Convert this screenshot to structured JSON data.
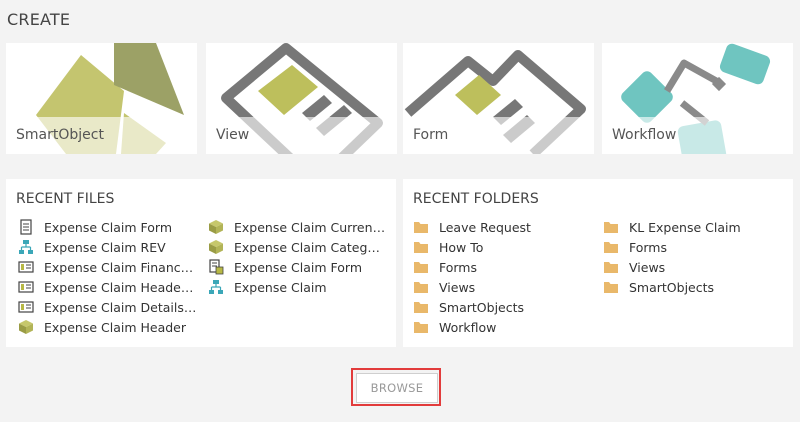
{
  "create": {
    "title": "CREATE",
    "tiles": [
      {
        "label": "SmartObject"
      },
      {
        "label": "View"
      },
      {
        "label": "Form"
      },
      {
        "label": "Workflow"
      }
    ]
  },
  "recent_files": {
    "title": "RECENT FILES",
    "items": [
      {
        "label": "Expense Claim Form",
        "icon": "form-icon"
      },
      {
        "label": "Expense Claim REV",
        "icon": "workflow-icon"
      },
      {
        "label": "Expense Claim Finance P...",
        "icon": "view-icon"
      },
      {
        "label": "Expense Claim Header V...",
        "icon": "view-icon"
      },
      {
        "label": "Expense Claim Details Vi...",
        "icon": "view-icon"
      },
      {
        "label": "Expense Claim Header",
        "icon": "smartobject-icon"
      },
      {
        "label": "Expense Claim Currency...",
        "icon": "smartobject-icon"
      },
      {
        "label": "Expense Claim Categories",
        "icon": "smartobject-icon"
      },
      {
        "label": "Expense Claim Form",
        "icon": "form-checkout-icon"
      },
      {
        "label": "Expense Claim",
        "icon": "workflow-icon"
      }
    ]
  },
  "recent_folders": {
    "title": "RECENT FOLDERS",
    "items": [
      {
        "label": "Leave Request"
      },
      {
        "label": "How To"
      },
      {
        "label": "Forms"
      },
      {
        "label": "Views"
      },
      {
        "label": "SmartObjects"
      },
      {
        "label": "Workflow"
      },
      {
        "label": "KL Expense Claim"
      },
      {
        "label": "Forms"
      },
      {
        "label": "Views"
      },
      {
        "label": "SmartObjects"
      }
    ]
  },
  "browse_label": "BROWSE",
  "colors": {
    "olive": "#bdbf5c",
    "olive_dark": "#9ca166",
    "grey": "#777777",
    "teal": "#6fc5c0",
    "folder": "#e9b86a"
  }
}
